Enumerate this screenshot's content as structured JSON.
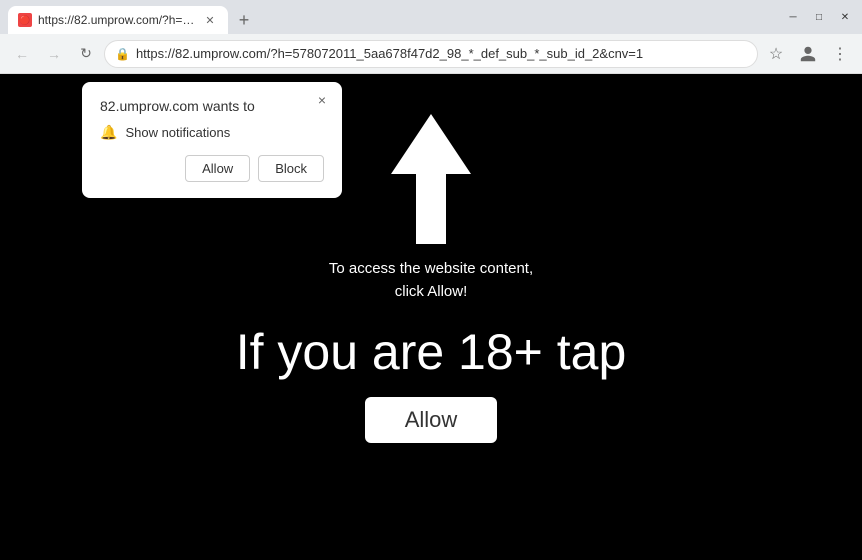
{
  "browser": {
    "tab": {
      "title": "https://82.umprow.com/?h=578...",
      "favicon_label": "🔴"
    },
    "new_tab_label": "+",
    "window_controls": {
      "minimize": "─",
      "maximize": "□",
      "close": "✕"
    },
    "address_bar": {
      "url": "https://82.umprow.com/?h=578072011_5aa678f47d2_98_*_def_sub_*_sub_id_2&cnv=1",
      "lock_icon": "🔒"
    },
    "nav": {
      "back": "←",
      "forward": "→",
      "refresh": "↻"
    }
  },
  "notification_popup": {
    "title": "82.umprow.com wants to",
    "permission_label": "Show notifications",
    "allow_label": "Allow",
    "block_label": "Block",
    "close_label": "×"
  },
  "page": {
    "access_text_line1": "To access the website content,",
    "access_text_line2": "click Allow!",
    "age_text": "If you are 18+ tap",
    "allow_button_label": "Allow",
    "background_color": "#000000"
  }
}
